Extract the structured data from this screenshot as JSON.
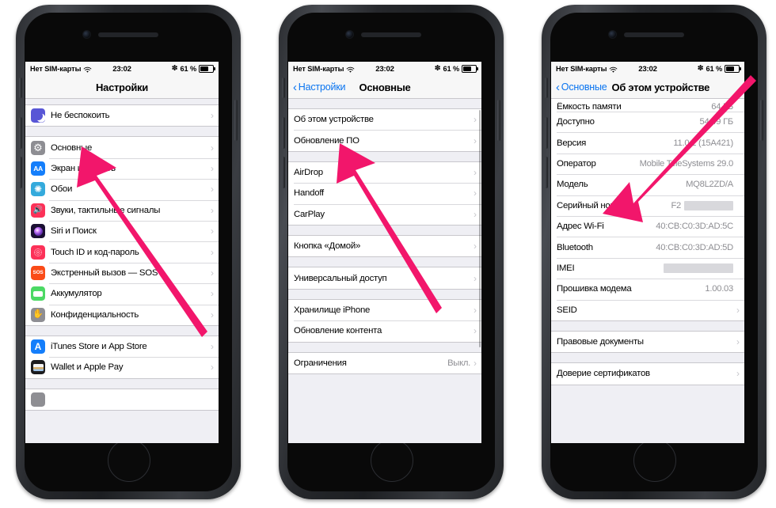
{
  "status_bar": {
    "carrier": "Нет SIM-карты",
    "wifi_icon": "wifi-icon",
    "time": "23:02",
    "bluetooth_icon": "bluetooth-icon",
    "battery_percent": "61 %",
    "battery_icon": "battery-icon",
    "battery_level": 61
  },
  "colors": {
    "arrow": "#F2166B",
    "accent_blue": "#0A74F0",
    "list_bg": "#EFEFF4",
    "separator": "#C8C7CC",
    "value_gray": "#8E8E93"
  },
  "phones": [
    {
      "id": "settings-root",
      "nav": {
        "title": "Настройки",
        "back_label": null
      },
      "groups": [
        {
          "rows": [
            {
              "label": "Не беспокоить",
              "icon": "do-not-disturb-icon",
              "icon_bg": "#5856D6",
              "chevron": true
            }
          ]
        },
        {
          "rows": [
            {
              "label": "Основные",
              "icon": "gear-icon",
              "icon_bg": "#8E8E93",
              "chevron": true
            },
            {
              "label": "Экран и яркость",
              "icon": "display-brightness-icon",
              "icon_bg": "#147EFB",
              "chevron": true
            },
            {
              "label": "Обои",
              "icon": "wallpaper-icon",
              "icon_bg": "#34AADC",
              "chevron": true
            },
            {
              "label": "Звуки, тактильные сигналы",
              "icon": "sounds-icon",
              "icon_bg": "#FC3158",
              "chevron": true
            },
            {
              "label": "Siri и Поиск",
              "icon": "siri-icon",
              "icon_bg": "#1B1033",
              "chevron": true
            },
            {
              "label": "Touch ID и код-пароль",
              "icon": "touch-id-icon",
              "icon_bg": "#FC3158",
              "chevron": true
            },
            {
              "label": "Экстренный вызов — SOS",
              "icon": "sos-icon",
              "icon_bg": "#FA4B18",
              "chevron": true
            },
            {
              "label": "Аккумулятор",
              "icon": "battery-icon",
              "icon_bg": "#4CD964",
              "chevron": true
            },
            {
              "label": "Конфиденциальность",
              "icon": "privacy-hand-icon",
              "icon_bg": "#8E8E93",
              "chevron": true
            }
          ]
        },
        {
          "rows": [
            {
              "label": "iTunes Store и App Store",
              "icon": "app-store-icon",
              "icon_bg": "#147EFB",
              "chevron": true
            },
            {
              "label": "Wallet и Apple Pay",
              "icon": "wallet-icon",
              "icon_bg": "#1C1C1E",
              "chevron": true
            }
          ]
        }
      ]
    },
    {
      "id": "general",
      "nav": {
        "title": "Основные",
        "back_label": "Настройки"
      },
      "groups": [
        {
          "rows": [
            {
              "label": "Об этом устройстве",
              "chevron": true
            },
            {
              "label": "Обновление ПО",
              "chevron": true
            }
          ]
        },
        {
          "rows": [
            {
              "label": "AirDrop",
              "chevron": true
            },
            {
              "label": "Handoff",
              "chevron": true
            },
            {
              "label": "CarPlay",
              "chevron": true
            }
          ]
        },
        {
          "rows": [
            {
              "label": "Кнопка «Домой»",
              "chevron": true
            }
          ]
        },
        {
          "rows": [
            {
              "label": "Универсальный доступ",
              "chevron": true
            }
          ]
        },
        {
          "rows": [
            {
              "label": "Хранилище iPhone",
              "chevron": true
            },
            {
              "label": "Обновление контента",
              "chevron": true
            }
          ]
        },
        {
          "rows": [
            {
              "label": "Ограничения",
              "value": "Выкл.",
              "chevron": true
            }
          ]
        }
      ]
    },
    {
      "id": "about-device",
      "nav": {
        "title": "Об этом устройстве",
        "back_label": "Основные"
      },
      "groups": [
        {
          "rows": [
            {
              "label": "Ёмкость памяти",
              "value": "64 ГБ",
              "chevron": false,
              "clipped": true
            },
            {
              "label": "Доступно",
              "value": "54,49 ГБ",
              "chevron": false
            },
            {
              "label": "Версия",
              "value": "11.0.2 (15A421)",
              "chevron": false
            },
            {
              "label": "Оператор",
              "value": "Mobile TeleSystems 29.0",
              "chevron": false
            },
            {
              "label": "Модель",
              "value": "MQ8L2ZD/A",
              "chevron": false
            },
            {
              "label": "Серийный номер",
              "value": "F2",
              "redacted": true,
              "redact_width": 62,
              "chevron": false
            },
            {
              "label": "Адрес Wi-Fi",
              "value": "40:CB:C0:3D:AD:5C",
              "chevron": false
            },
            {
              "label": "Bluetooth",
              "value": "40:CB:C0:3D:AD:5D",
              "chevron": false
            },
            {
              "label": "IMEI",
              "value": "",
              "redacted": true,
              "redact_width": 88,
              "chevron": false
            },
            {
              "label": "Прошивка модема",
              "value": "1.00.03",
              "chevron": false
            },
            {
              "label": "SEID",
              "chevron": true
            }
          ]
        },
        {
          "rows": [
            {
              "label": "Правовые документы",
              "chevron": true
            }
          ]
        },
        {
          "rows": [
            {
              "label": "Доверие сертификатов",
              "chevron": true
            }
          ]
        }
      ]
    }
  ],
  "annotations": [
    {
      "name": "arrow-to-osnovnye",
      "target": "Основные",
      "phone": 1
    },
    {
      "name": "arrow-to-ob-etom-ustroystve",
      "target": "Об этом устройстве",
      "phone": 2
    },
    {
      "name": "arrow-to-seriyny-nomer",
      "target": "Серийный номер",
      "phone": 3
    }
  ]
}
